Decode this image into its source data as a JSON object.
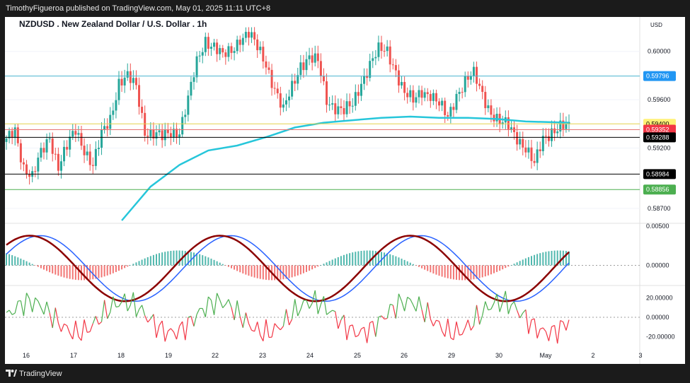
{
  "header": {
    "publisher_line": "TimothyFigueroa published on TradingView.com, May 01, 2025 11:11 UTC+8"
  },
  "footer": {
    "brand": "TradingView"
  },
  "chart_data": {
    "type": "candlestick",
    "title": "NZDUSD . New Zealand Dollar / U.S. Dollar . 1h",
    "currency": "USD",
    "x_ticks": [
      "16",
      "17",
      "18",
      "19",
      "22",
      "23",
      "24",
      "25",
      "26",
      "29",
      "30",
      "May",
      "2",
      "3"
    ],
    "price_panel": {
      "y_ticks": [
        "0.60000",
        "0.59600",
        "0.59200",
        "0.58700"
      ],
      "ylim": [
        0.586,
        0.6025
      ],
      "close_path": [
        [
          0,
          0.5925
        ],
        [
          3,
          0.5935
        ],
        [
          6,
          0.5905
        ],
        [
          9,
          0.5895
        ],
        [
          12,
          0.5915
        ],
        [
          15,
          0.593
        ],
        [
          18,
          0.5905
        ],
        [
          21,
          0.592
        ],
        [
          24,
          0.5935
        ],
        [
          27,
          0.592
        ],
        [
          30,
          0.5905
        ],
        [
          33,
          0.593
        ],
        [
          36,
          0.5945
        ],
        [
          39,
          0.5975
        ],
        [
          42,
          0.5978
        ],
        [
          45,
          0.597
        ],
        [
          48,
          0.5935
        ],
        [
          51,
          0.5932
        ],
        [
          54,
          0.5928
        ],
        [
          57,
          0.5933
        ],
        [
          60,
          0.5935
        ],
        [
          63,
          0.596
        ],
        [
          66,
          0.599
        ],
        [
          69,
          0.601
        ],
        [
          72,
          0.6005
        ],
        [
          75,
          0.5995
        ],
        [
          78,
          0.6
        ],
        [
          81,
          0.6012
        ],
        [
          84,
          0.6015
        ],
        [
          87,
          0.6002
        ],
        [
          90,
          0.599
        ],
        [
          93,
          0.597
        ],
        [
          96,
          0.595
        ],
        [
          99,
          0.597
        ],
        [
          102,
          0.599
        ],
        [
          105,
          0.5995
        ],
        [
          108,
          0.599
        ],
        [
          111,
          0.596
        ],
        [
          114,
          0.5955
        ],
        [
          117,
          0.595
        ],
        [
          120,
          0.5955
        ],
        [
          123,
          0.5975
        ],
        [
          126,
          0.599
        ],
        [
          129,
          0.6
        ],
        [
          132,
          0.6
        ],
        [
          135,
          0.5985
        ],
        [
          138,
          0.5965
        ],
        [
          141,
          0.5958
        ],
        [
          144,
          0.5968
        ],
        [
          147,
          0.5965
        ],
        [
          150,
          0.5955
        ],
        [
          153,
          0.5945
        ],
        [
          156,
          0.5965
        ],
        [
          159,
          0.5975
        ],
        [
          162,
          0.598
        ],
        [
          165,
          0.5965
        ],
        [
          168,
          0.595
        ],
        [
          171,
          0.594
        ],
        [
          174,
          0.5938
        ],
        [
          177,
          0.593
        ],
        [
          180,
          0.592
        ],
        [
          183,
          0.5905
        ],
        [
          186,
          0.5928
        ],
        [
          189,
          0.5935
        ],
        [
          192,
          0.5937
        ],
        [
          195,
          0.5936
        ]
      ],
      "ma_line": [
        [
          40,
          0.586
        ],
        [
          50,
          0.5888
        ],
        [
          60,
          0.5906
        ],
        [
          70,
          0.5918
        ],
        [
          80,
          0.5922
        ],
        [
          90,
          0.5929
        ],
        [
          100,
          0.5937
        ],
        [
          110,
          0.5941
        ],
        [
          120,
          0.5943
        ],
        [
          130,
          0.5945
        ],
        [
          140,
          0.5946
        ],
        [
          150,
          0.5945
        ],
        [
          160,
          0.5945
        ],
        [
          170,
          0.5944
        ],
        [
          180,
          0.5942
        ],
        [
          195,
          0.5941
        ]
      ],
      "levels": [
        {
          "label": "0.59796",
          "value": 0.59796,
          "line": "#4ab5d0",
          "badge_bg": "#2196f3",
          "badge_fg": "#ffffff"
        },
        {
          "label": "0.59400",
          "value": 0.594,
          "line": "#e6d24a",
          "badge_bg": "#fff176",
          "badge_fg": "#000000"
        },
        {
          "label": "0.59352",
          "value": 0.59352,
          "line": "#e57373",
          "badge_bg": "#f23645",
          "badge_fg": "#ffffff"
        },
        {
          "label": "0.59288",
          "value": 0.59288,
          "line": "#000000",
          "badge_bg": "#000000",
          "badge_fg": "#ffffff"
        },
        {
          "label": "0.58984",
          "value": 0.58984,
          "line": "#000000",
          "badge_bg": "#000000",
          "badge_fg": "#ffffff"
        },
        {
          "label": "0.58856",
          "value": 0.58856,
          "line": "#4caf50",
          "badge_bg": "#4caf50",
          "badge_fg": "#ffffff"
        }
      ]
    },
    "macd_panel": {
      "y_ticks": [
        "0.00500",
        "0.00000"
      ],
      "ylim": [
        -0.0024,
        0.0052
      ]
    },
    "osc_panel": {
      "y_ticks": [
        "20.00000",
        "0.00000",
        "-20.00000"
      ],
      "ylim": [
        -30,
        30
      ]
    },
    "colors": {
      "up": "#26a69a",
      "down": "#ef5350",
      "ma": "#26c6da",
      "macd_fast": "#8b0000",
      "macd_slow": "#2962ff",
      "osc_up": "#4caf50",
      "osc_down": "#f23645"
    }
  }
}
